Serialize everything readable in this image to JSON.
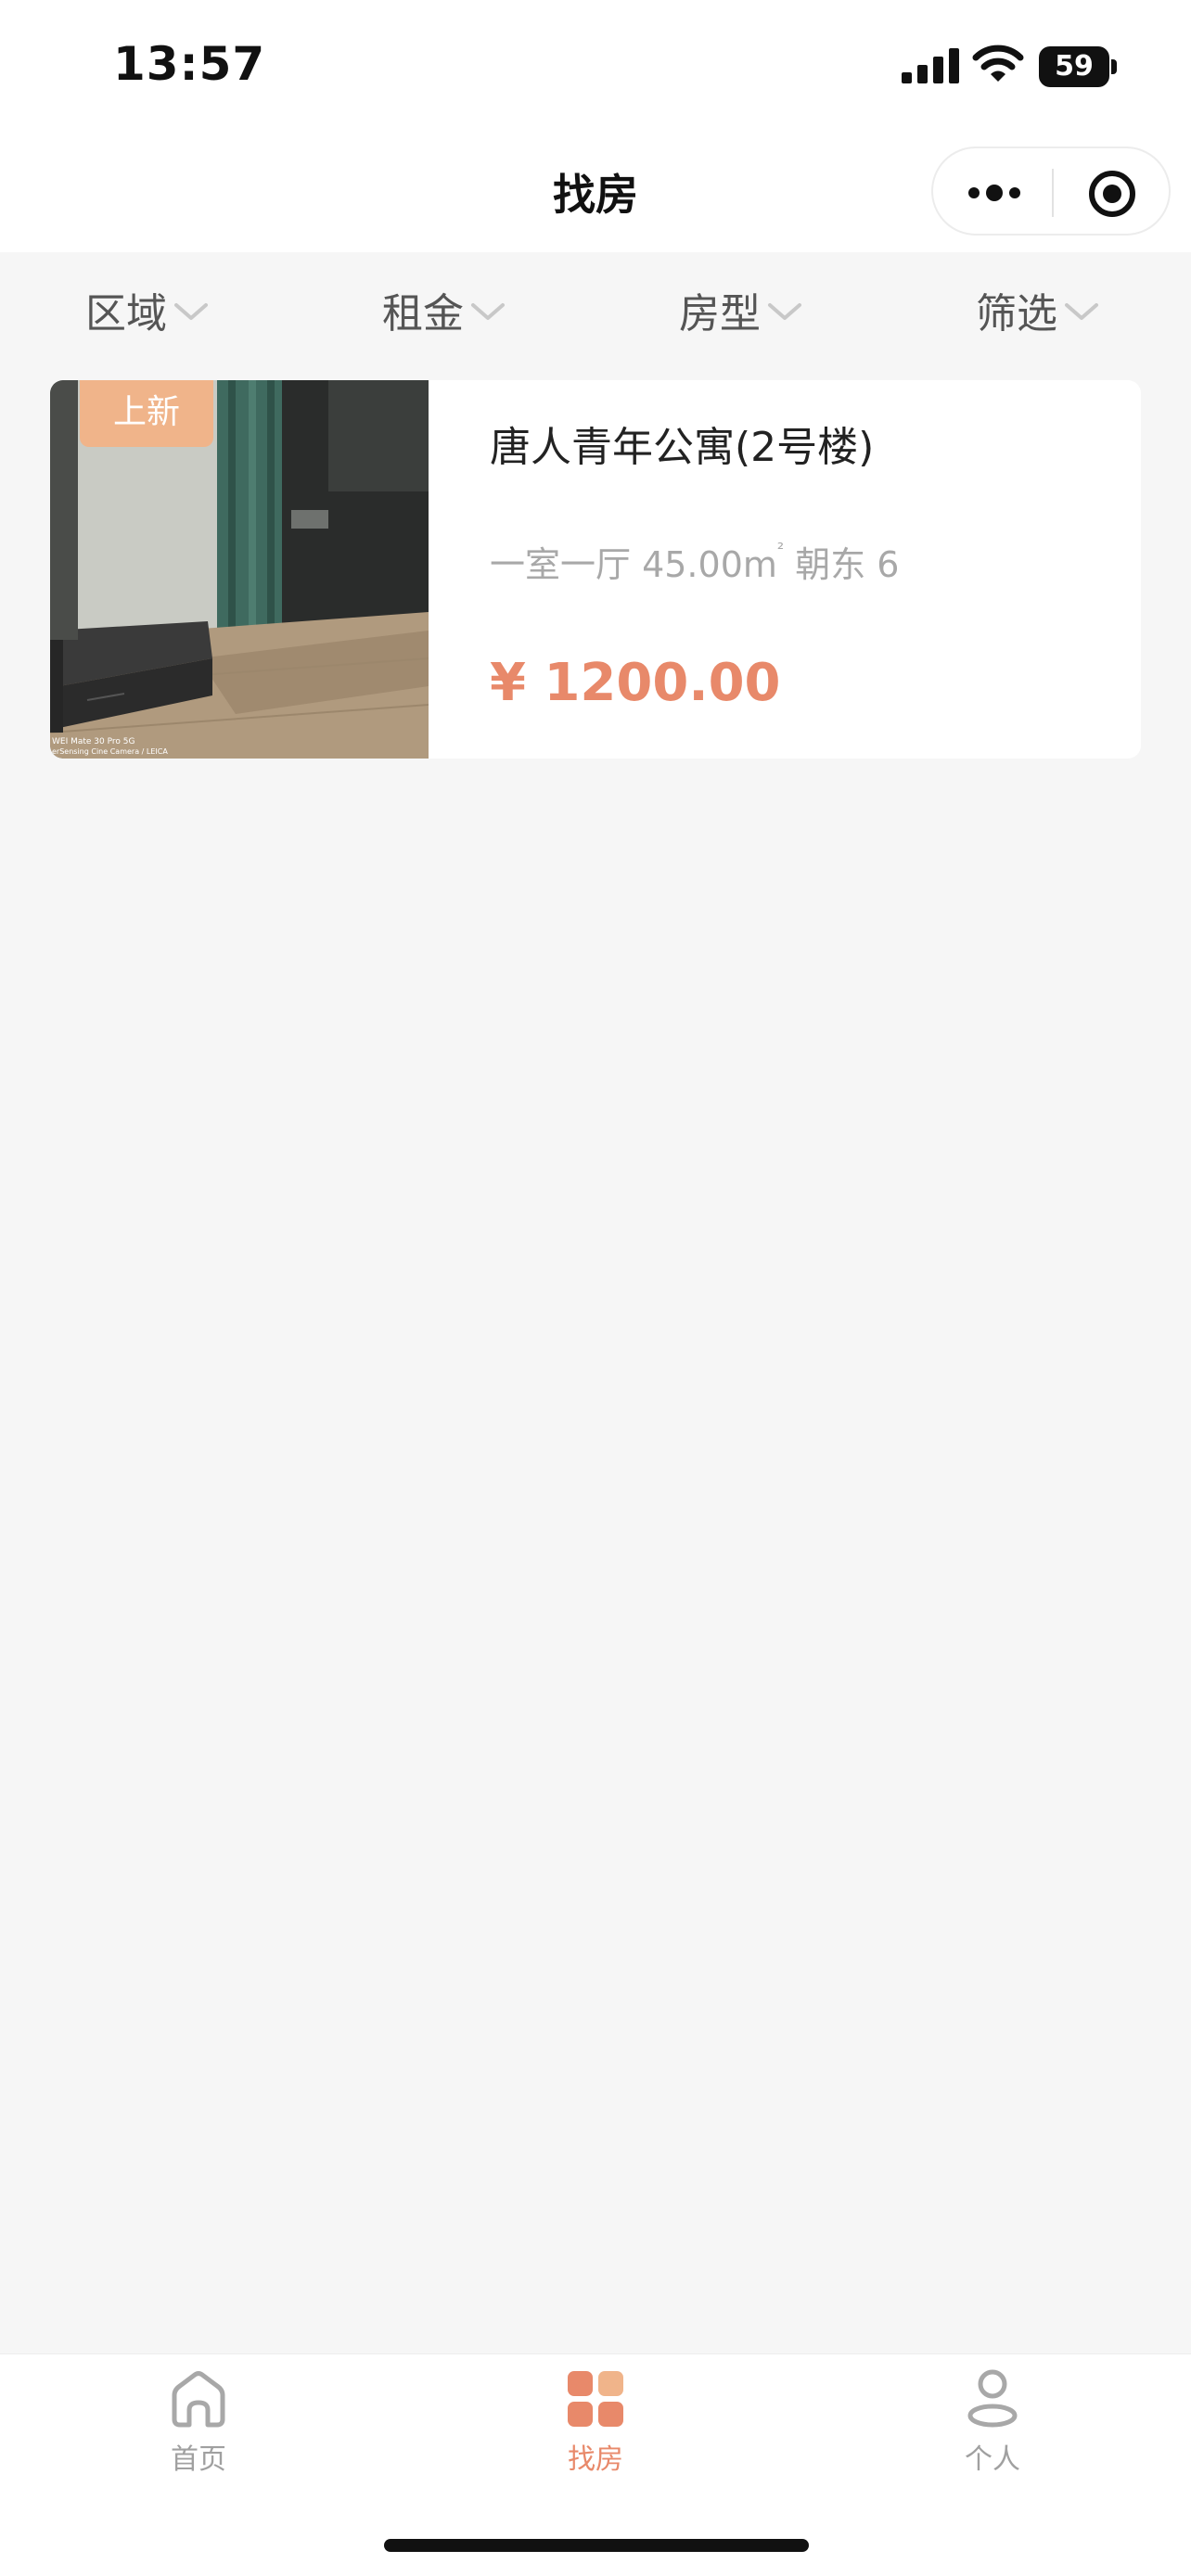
{
  "status_bar": {
    "time": "13:57",
    "battery_level": "59"
  },
  "nav": {
    "title": "找房"
  },
  "filters": [
    {
      "label": "区域"
    },
    {
      "label": "租金"
    },
    {
      "label": "房型"
    },
    {
      "label": "筛选"
    }
  ],
  "listing": {
    "badge": "上新",
    "title": "唐人青年公寓(2号楼)",
    "meta_prefix": "一室一厅 45.00m",
    "meta_unit_sup": "²",
    "meta_suffix": " 朝东 6",
    "price": "¥ 1200.00",
    "photo_watermark_line1": "WEI Mate 30 Pro 5G",
    "photo_watermark_line2": "erSensing Cine Camera / LEICA"
  },
  "tabbar": {
    "items": [
      {
        "label": "首页",
        "icon": "home-icon",
        "active": false
      },
      {
        "label": "找房",
        "icon": "grid-icon",
        "active": true
      },
      {
        "label": "个人",
        "icon": "person-icon",
        "active": false
      }
    ]
  },
  "colors": {
    "accent": "#e8896a",
    "badge": "#f0b48a",
    "background": "#f6f6f6"
  }
}
